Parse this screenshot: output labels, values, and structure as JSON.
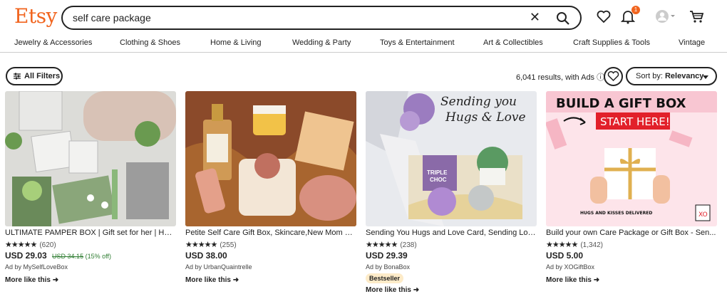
{
  "brand": {
    "logo": "Etsy",
    "color": "#f1641e"
  },
  "search": {
    "query": "self care package",
    "clear_icon": "close-icon",
    "submit_icon": "search-icon"
  },
  "header": {
    "notification_count": "1"
  },
  "categories": [
    "Jewelry & Accessories",
    "Clothing & Shoes",
    "Home & Living",
    "Wedding & Party",
    "Toys & Entertainment",
    "Art & Collectibles",
    "Craft Supplies & Tools",
    "Vintage"
  ],
  "filters": {
    "all_filters_label": "All Filters",
    "results_text": "6,041 results, with Ads",
    "sort_prefix": "Sort by: ",
    "sort_value": "Relevancy"
  },
  "products": [
    {
      "title": "ULTIMATE PAMPER BOX | Gift set for her | Ham...",
      "stars": "★★★★★",
      "reviews": "(620)",
      "price": "USD 29.03",
      "old_price": "USD 34.15",
      "discount": "(15% off)",
      "seller": "Ad by MySelfLoveBox",
      "more": "More like this",
      "badge": ""
    },
    {
      "title": "Petite Self Care Gift Box, Skincare,New Mom G...",
      "stars": "★★★★★",
      "reviews": "(255)",
      "price": "USD 38.00",
      "old_price": "",
      "discount": "",
      "seller": "Ad by UrbanQuaintrelle",
      "more": "More like this",
      "badge": ""
    },
    {
      "title": "Sending You Hugs and Love Card, Sending Lov...",
      "stars": "★★★★★",
      "reviews": "(238)",
      "price": "USD 29.39",
      "old_price": "",
      "discount": "",
      "seller": "Ad by BonaBox",
      "more": "More like this",
      "badge": "Bestseller",
      "image_text": [
        "Sending you",
        "Hugs & Love"
      ],
      "product_label": [
        "TRIPLE",
        "CHOC"
      ]
    },
    {
      "title": "Build your own Care Package or Gift Box - Sen...",
      "stars": "★★★★★",
      "reviews": "(1,342)",
      "price": "USD 5.00",
      "old_price": "",
      "discount": "",
      "seller": "Ad by XOGiftBox",
      "more": "More like this",
      "badge": "",
      "image_text": [
        "BUILD A GIFT BOX",
        "START HERE!",
        "HUGS AND KISSES DELIVERED"
      ]
    }
  ]
}
